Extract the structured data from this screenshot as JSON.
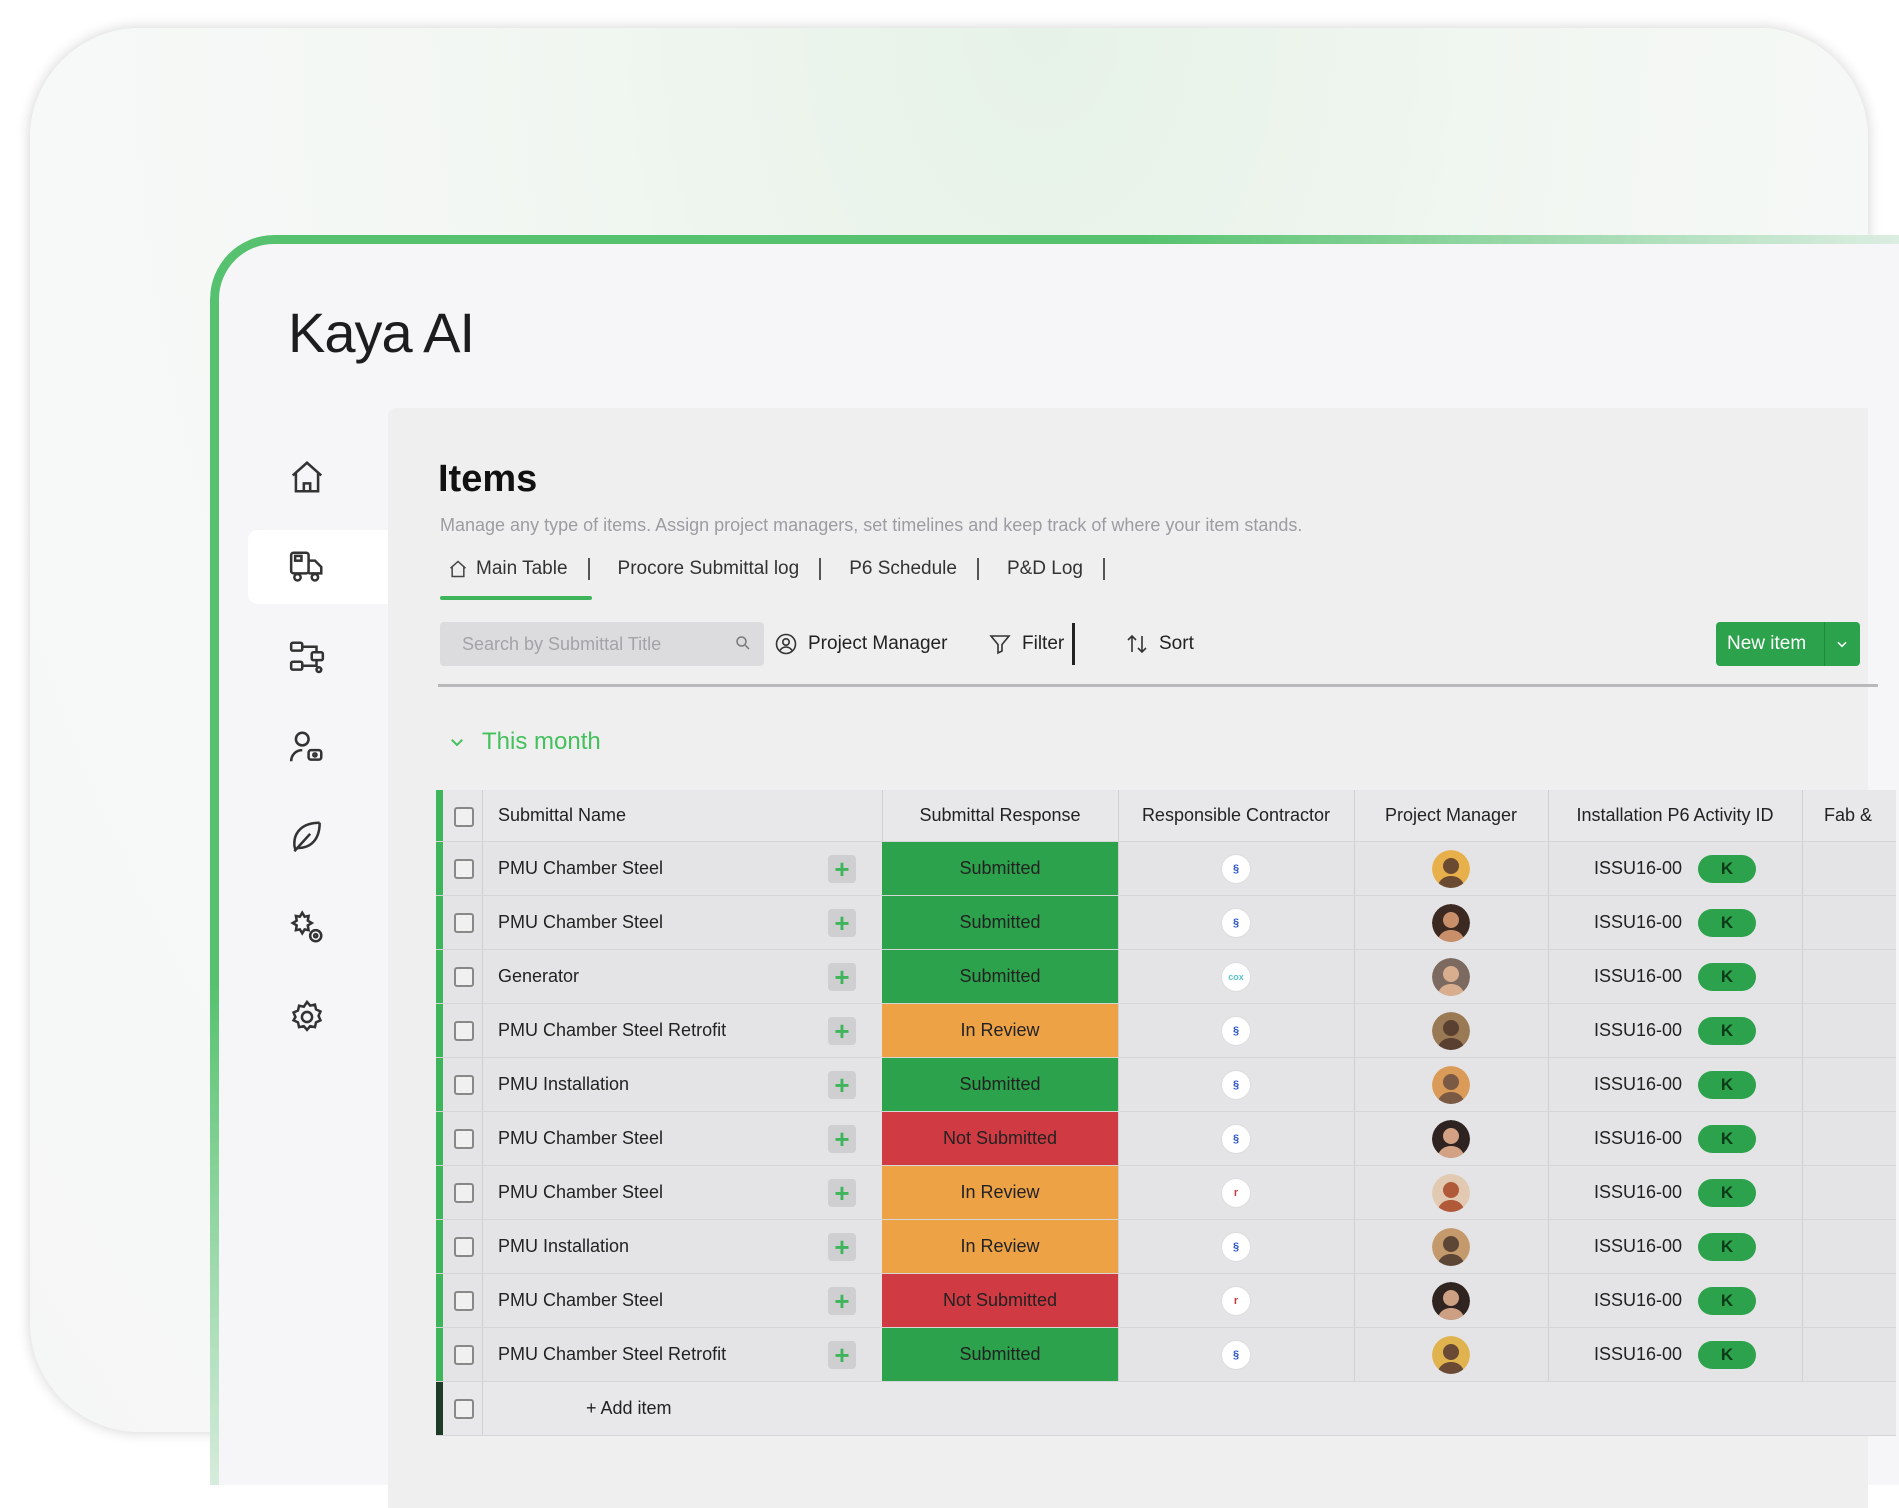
{
  "app": {
    "logo": "Kaya AI"
  },
  "colors": {
    "accent": "#3fb55b",
    "submitted": "#2ba24b",
    "in_review": "#eda246",
    "not_submitted": "#cf3a43"
  },
  "sidebar": {
    "items": [
      {
        "icon": "home-icon",
        "active": false
      },
      {
        "icon": "truck-icon",
        "active": true
      },
      {
        "icon": "workflow-icon",
        "active": false
      },
      {
        "icon": "user-settings-icon",
        "active": false
      },
      {
        "icon": "leaf-icon",
        "active": false
      },
      {
        "icon": "gear-cluster-icon",
        "active": false
      },
      {
        "icon": "settings-gear-icon",
        "active": false
      }
    ]
  },
  "page": {
    "title": "Items",
    "subtitle": "Manage any type of items. Assign project managers, set timelines and keep track of where your item stands."
  },
  "tabs": [
    "Main Table",
    "Procore Submittal log",
    "P6 Schedule",
    "P&D Log"
  ],
  "toolbar": {
    "search_placeholder": "Search by Submittal Title",
    "project_manager": "Project Manager",
    "filter": "Filter",
    "sort": "Sort",
    "new_item": "New item"
  },
  "group": {
    "label": "This month"
  },
  "table": {
    "headers": {
      "name": "Submittal Name",
      "response": "Submittal Response",
      "contractor": "Responsible Contractor",
      "pm": "Project Manager",
      "activity": "Installation P6 Activity ID",
      "fab": "Fab &"
    },
    "rows": [
      {
        "name": "PMU Chamber Steel",
        "response": "Submitted",
        "status": "submitted",
        "contractor": "blue",
        "activity": "ISSU16-00",
        "pill": "K"
      },
      {
        "name": "PMU Chamber Steel",
        "response": "Submitted",
        "status": "submitted",
        "contractor": "blue",
        "activity": "ISSU16-00",
        "pill": "K"
      },
      {
        "name": "Generator",
        "response": "Submitted",
        "status": "submitted",
        "contractor": "cox",
        "activity": "ISSU16-00",
        "pill": "K"
      },
      {
        "name": "PMU Chamber Steel Retrofit",
        "response": "In Review",
        "status": "in_review",
        "contractor": "blue",
        "activity": "ISSU16-00",
        "pill": "K"
      },
      {
        "name": "PMU Installation",
        "response": "Submitted",
        "status": "submitted",
        "contractor": "blue",
        "activity": "ISSU16-00",
        "pill": "K"
      },
      {
        "name": "PMU Chamber Steel",
        "response": "Not Submitted",
        "status": "not_submitted",
        "contractor": "blue",
        "activity": "ISSU16-00",
        "pill": "K"
      },
      {
        "name": "PMU Chamber Steel",
        "response": "In Review",
        "status": "in_review",
        "contractor": "red",
        "activity": "ISSU16-00",
        "pill": "K"
      },
      {
        "name": "PMU Installation",
        "response": "In Review",
        "status": "in_review",
        "contractor": "blue",
        "activity": "ISSU16-00",
        "pill": "K"
      },
      {
        "name": "PMU Chamber Steel",
        "response": "Not Submitted",
        "status": "not_submitted",
        "contractor": "red",
        "activity": "ISSU16-00",
        "pill": "K"
      },
      {
        "name": "PMU Chamber Steel Retrofit",
        "response": "Submitted",
        "status": "submitted",
        "contractor": "blue",
        "activity": "ISSU16-00",
        "pill": "K"
      }
    ],
    "add_item": "+ Add item"
  }
}
